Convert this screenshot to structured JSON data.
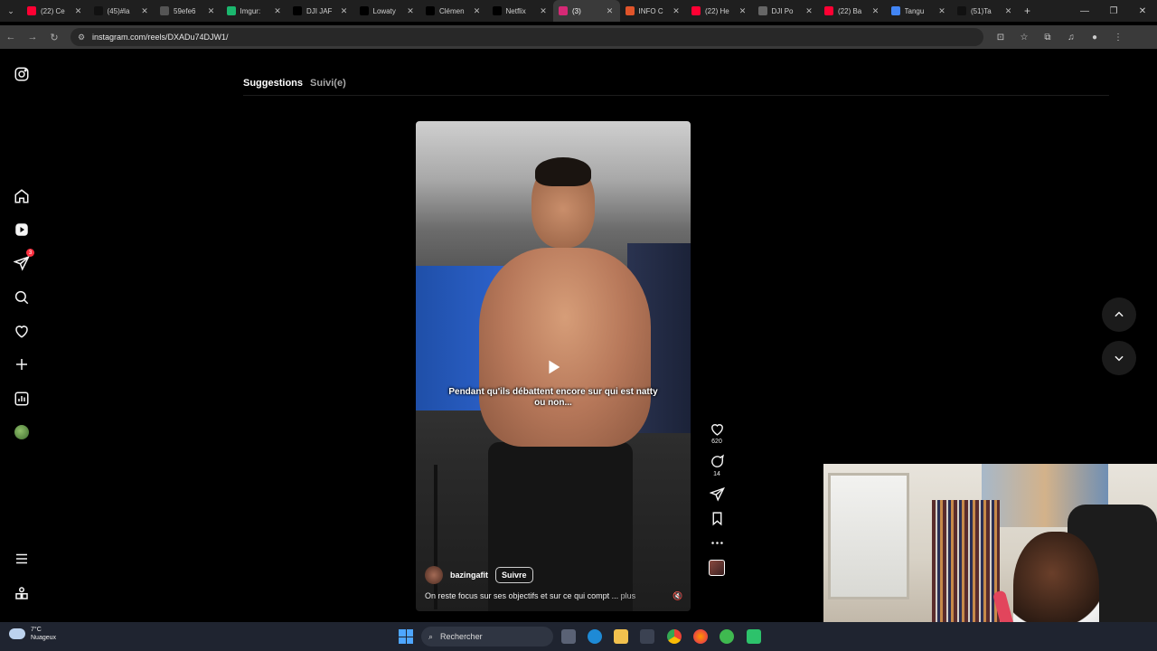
{
  "browser": {
    "tabs": [
      {
        "title": "(22) Ce",
        "icon": "youtube-icon",
        "color": "#ff0033"
      },
      {
        "title": "(45)#la",
        "icon": "tiktok-icon",
        "color": "#111111"
      },
      {
        "title": "59efe6",
        "icon": "globe-icon",
        "color": "#555555"
      },
      {
        "title": "Imgur:",
        "icon": "imgur-icon",
        "color": "#1bb76e"
      },
      {
        "title": "DJI JAF",
        "icon": "x-icon",
        "color": "#000000"
      },
      {
        "title": "Lowaty",
        "icon": "x-icon",
        "color": "#000000"
      },
      {
        "title": "Clémen",
        "icon": "x-icon",
        "color": "#000000"
      },
      {
        "title": "Netflix",
        "icon": "x-icon",
        "color": "#000000"
      },
      {
        "title": "(3)",
        "icon": "instagram-icon",
        "color": "#d62976",
        "active": true
      },
      {
        "title": "INFO C",
        "icon": "news-icon",
        "color": "#e0542a"
      },
      {
        "title": "(22) He",
        "icon": "youtube-icon",
        "color": "#ff0033"
      },
      {
        "title": "DJI Po",
        "icon": "document-icon",
        "color": "#666666"
      },
      {
        "title": "(22) Ba",
        "icon": "youtube-icon",
        "color": "#ff0033"
      },
      {
        "title": "Tangu",
        "icon": "google-icon",
        "color": "#4285f4"
      },
      {
        "title": "(51)Ta",
        "icon": "tiktok-icon",
        "color": "#111111"
      }
    ],
    "url": "instagram.com/reels/DXADu74DJW1/"
  },
  "instagram": {
    "feed_tabs": {
      "suggestions": "Suggestions",
      "following": "Suivi(e)"
    },
    "nav_badge": "3",
    "reel": {
      "caption_overlay": "Pendant qu'ils débattent encore sur qui est natty ou non...",
      "author": "bazingafit",
      "follow_label": "Suivre",
      "description": "On reste focus sur ses objectifs et sur ce qui compt ...",
      "more_label": "plus",
      "likes": "620",
      "comments": "14"
    }
  },
  "taskbar": {
    "temperature": "7°C",
    "weather": "Nuageux",
    "search_placeholder": "Rechercher"
  }
}
